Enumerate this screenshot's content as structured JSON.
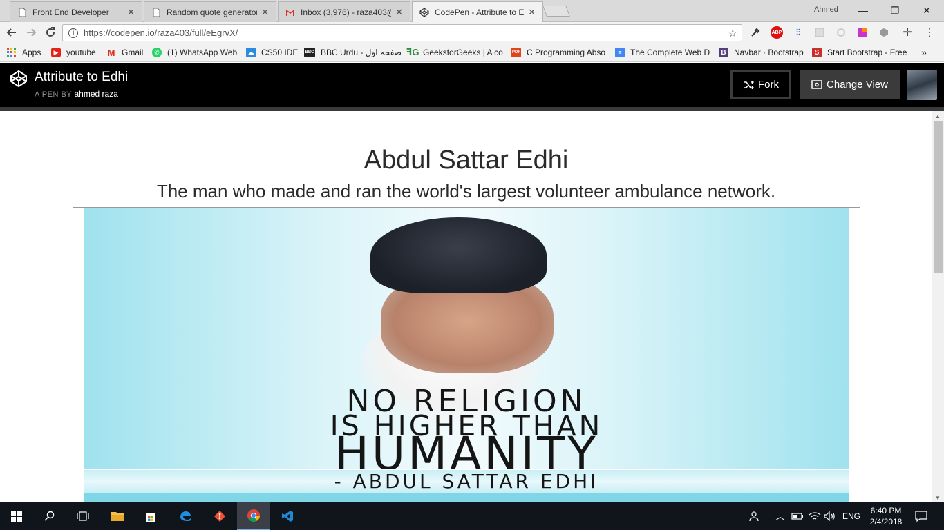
{
  "browser": {
    "tabs": [
      {
        "title": "Front End Developer",
        "icon": "page-icon",
        "active": false
      },
      {
        "title": "Random quote generator",
        "icon": "page-icon",
        "active": false
      },
      {
        "title": "Inbox (3,976) - raza403@",
        "icon": "gmail-icon",
        "active": false
      },
      {
        "title": "CodePen - Attribute to Edhi",
        "icon": "codepen-icon",
        "active": true
      }
    ],
    "profile_name": "Ahmed",
    "window_controls": {
      "minimize": "—",
      "restore": "❐",
      "close": "✕"
    },
    "url": "https://codepen.io/raza403/full/eEgrvX/",
    "bookmarks": [
      {
        "label": "Apps",
        "icon": "apps-grid-icon",
        "color": "#e04a3f"
      },
      {
        "label": "youtube",
        "icon": "youtube-icon",
        "color": "#e62117"
      },
      {
        "label": "Gmail",
        "icon": "gmail-icon",
        "color": "#d93025"
      },
      {
        "label": "(1) WhatsApp Web",
        "icon": "whatsapp-icon",
        "color": "#25d366"
      },
      {
        "label": "CS50 IDE",
        "icon": "cs50-icon",
        "color": "#2a8be0"
      },
      {
        "label": "BBC Urdu - صفحہ اول",
        "icon": "bbc-icon",
        "color": "#222222"
      },
      {
        "label": "GeeksforGeeks | A co",
        "icon": "geeksforgeeks-icon",
        "color": "#2f8d46"
      },
      {
        "label": "C Programming Abso",
        "icon": "pdf-icon",
        "color": "#e0441c"
      },
      {
        "label": "The Complete Web D",
        "icon": "google-docs-icon",
        "color": "#4285f4"
      },
      {
        "label": "Navbar · Bootstrap",
        "icon": "bootstrap-icon",
        "color": "#563d7c"
      },
      {
        "label": "Start Bootstrap - Free",
        "icon": "startbootstrap-icon",
        "color": "#c9302c"
      }
    ],
    "bookmarks_more": "»"
  },
  "codepen": {
    "pen_title": "Attribute to Edhi",
    "byline_prefix": "A PEN BY",
    "author": "ahmed raza",
    "fork_label": "Fork",
    "change_view_label": "Change View"
  },
  "page": {
    "title": "Abdul Sattar Edhi",
    "subtitle": "The man who made and ran the world's largest volunteer ambulance network.",
    "poster": {
      "line1": "NO RELIGION",
      "line2": "IS HIGHER THAN",
      "line3": "HUMANITY",
      "signature": "- ABDUL SATTAR EDHI"
    }
  },
  "taskbar": {
    "language": "ENG",
    "time": "6:40 PM",
    "date": "2/4/2018"
  }
}
